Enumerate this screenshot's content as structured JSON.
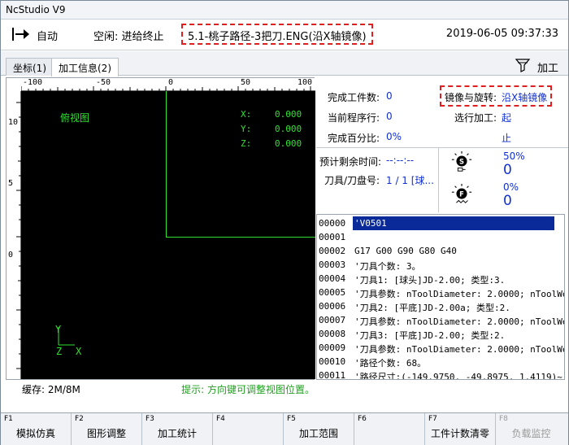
{
  "window": {
    "title": "NcStudio V9"
  },
  "status": {
    "mode": "自动",
    "state": "空闲: 进给终止",
    "file": "5.1-桃子路径-3把刀.ENG(沿X轴镜像)",
    "datetime": "2019-06-05 09:37:33",
    "accent_red": "#e02020"
  },
  "tabs": [
    {
      "label": "坐标(1)",
      "active": false
    },
    {
      "label": "加工信息(2)",
      "active": true
    }
  ],
  "process_label": "加工",
  "view": {
    "title": "俯视图",
    "ruler_top": [
      "-100",
      "-50",
      "0",
      "50",
      "100"
    ],
    "ruler_left": [
      "10",
      "0",
      "5",
      "0",
      "0"
    ],
    "coords": [
      {
        "axis": "X:",
        "value": "0.000"
      },
      {
        "axis": "Y:",
        "value": "0.000"
      },
      {
        "axis": "Z:",
        "value": "0.000"
      }
    ],
    "axis_y": "Y",
    "axis_z": "Z",
    "axis_x": "X",
    "line_color": "#30e030"
  },
  "bottom": {
    "cache": "缓存: 2M/8M",
    "hint": "提示: 方向键可调整视图位置。"
  },
  "info": {
    "completed_label": "完成工件数:",
    "completed_value": "0",
    "current_line_label": "当前程序行:",
    "current_line_value": "0",
    "percent_label": "完成百分比:",
    "percent_value": "0%",
    "mirror_label": "镜像与旋转:",
    "mirror_value": "沿X轴镜像",
    "select_label": "选行加工:",
    "select_start": "起",
    "select_end": "止",
    "remaining_label": "预计剩余时间:",
    "remaining_value": "--:--:--",
    "tool_label": "刀具/刀盘号:",
    "tool_value": "1 / 1 [球...",
    "spindle_pct": "50%",
    "spindle_val": "0",
    "feed_pct": "0%",
    "feed_val": "0"
  },
  "code": [
    {
      "num": "00000",
      "text": "'V0501",
      "selected": true
    },
    {
      "num": "00001",
      "text": ""
    },
    {
      "num": "00002",
      "text": "G17 G00 G90 G80 G40"
    },
    {
      "num": "00003",
      "text": "'刀具个数: 3。"
    },
    {
      "num": "00004",
      "text": "'刀具1: [球头]JD-2.00; 类型:3."
    },
    {
      "num": "00005",
      "text": "'刀具参数: nToolDiameter: 2.0000; nToolWe"
    },
    {
      "num": "00006",
      "text": "'刀具2: [平底]JD-2.00a; 类型:2."
    },
    {
      "num": "00007",
      "text": "'刀具参数: nToolDiameter: 2.0000; nToolWe"
    },
    {
      "num": "00008",
      "text": "'刀具3: [平底]JD-2.00; 类型:2."
    },
    {
      "num": "00009",
      "text": "'刀具参数: nToolDiameter: 2.0000; nToolWe"
    },
    {
      "num": "00010",
      "text": "'路径个数: 68。"
    },
    {
      "num": "00011",
      "text": "'路径尺寸:(-149.9750, -49.8975, 1.4119)~("
    }
  ],
  "fkeys": [
    {
      "key": "F1",
      "label": "模拟仿真",
      "enabled": true
    },
    {
      "key": "F2",
      "label": "图形调整",
      "enabled": true
    },
    {
      "key": "F3",
      "label": "加工统计",
      "enabled": true
    },
    {
      "key": "F4",
      "label": "",
      "enabled": true
    },
    {
      "key": "F5",
      "label": "加工范围",
      "enabled": true
    },
    {
      "key": "F6",
      "label": "",
      "enabled": true
    },
    {
      "key": "F7",
      "label": "工件计数清零",
      "enabled": true
    },
    {
      "key": "F8",
      "label": "负载监控",
      "enabled": false
    }
  ]
}
